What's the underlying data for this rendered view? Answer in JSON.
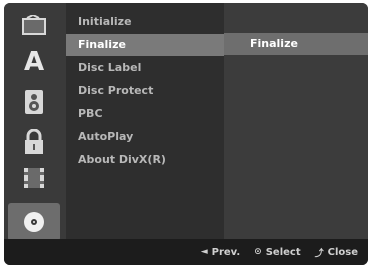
{
  "sidebar": {
    "icons": [
      {
        "name": "movie-icon"
      },
      {
        "name": "language-icon",
        "glyph": "A"
      },
      {
        "name": "audio-icon"
      },
      {
        "name": "lock-icon"
      },
      {
        "name": "recording-icon"
      },
      {
        "name": "disc-icon"
      }
    ]
  },
  "menu": {
    "items": [
      {
        "label": "Initialize"
      },
      {
        "label": "Finalize"
      },
      {
        "label": "Disc Label"
      },
      {
        "label": "Disc Protect"
      },
      {
        "label": "PBC"
      },
      {
        "label": "AutoPlay"
      },
      {
        "label": "About DivX(R)"
      }
    ],
    "selected_index": 1
  },
  "submenu": {
    "selected_label": "Finalize"
  },
  "footer": {
    "prev_glyph": "◄",
    "prev_label": "Prev.",
    "select_glyph": "⊙",
    "select_label": "Select",
    "close_glyph": "⤴",
    "close_label": "Close"
  },
  "colors": {
    "background": "#2a2a2a",
    "highlight": "#7a7a7a",
    "text": "#b8b8b8"
  }
}
